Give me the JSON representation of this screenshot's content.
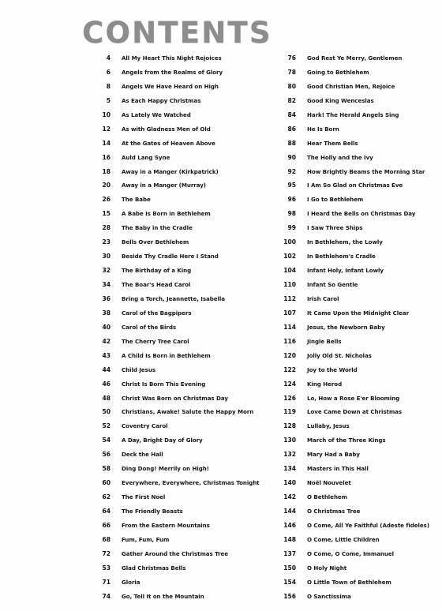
{
  "document": {
    "heading": "CONTENTS",
    "heading_color": "#8d8d8d",
    "background_color": "#ffffff",
    "text_color": "#161616"
  },
  "toc": {
    "left_column": [
      {
        "page": "4",
        "title": "All My Heart This Night Rejoices"
      },
      {
        "page": "6",
        "title": "Angels from the Realms of Glory"
      },
      {
        "page": "8",
        "title": "Angels We Have Heard on High"
      },
      {
        "page": "5",
        "title": "As Each Happy Christmas"
      },
      {
        "page": "10",
        "title": "As Lately We Watched"
      },
      {
        "page": "12",
        "title": "As with Gladness Men of Old"
      },
      {
        "page": "14",
        "title": "At the Gates of Heaven Above"
      },
      {
        "page": "16",
        "title": "Auld Lang Syne"
      },
      {
        "page": "18",
        "title": "Away in a Manger (Kirkpatrick)"
      },
      {
        "page": "20",
        "title": "Away in a Manger (Murray)"
      },
      {
        "page": "26",
        "title": "The Babe"
      },
      {
        "page": "15",
        "title": "A Babe Is Born in Bethlehem"
      },
      {
        "page": "28",
        "title": "The Baby in the Cradle"
      },
      {
        "page": "23",
        "title": "Bells Over Bethlehem"
      },
      {
        "page": "30",
        "title": "Beside Thy Cradle Here I Stand"
      },
      {
        "page": "32",
        "title": "The Birthday of a King"
      },
      {
        "page": "34",
        "title": "The Boar's Head Carol"
      },
      {
        "page": "36",
        "title": "Bring a Torch, Jeannette, Isabella"
      },
      {
        "page": "38",
        "title": "Carol of the Bagpipers"
      },
      {
        "page": "40",
        "title": "Carol of the Birds"
      },
      {
        "page": "42",
        "title": "The Cherry Tree Carol"
      },
      {
        "page": "43",
        "title": "A Child Is Born in Bethlehem"
      },
      {
        "page": "44",
        "title": "Child Jesus"
      },
      {
        "page": "46",
        "title": "Christ Is Born This Evening"
      },
      {
        "page": "48",
        "title": "Christ Was Born on Christmas Day"
      },
      {
        "page": "50",
        "title": "Christians, Awake! Salute the Happy Morn"
      },
      {
        "page": "52",
        "title": "Coventry Carol"
      },
      {
        "page": "54",
        "title": "A Day, Bright Day of Glory"
      },
      {
        "page": "56",
        "title": "Deck the Hall"
      },
      {
        "page": "58",
        "title": "Ding Dong! Merrily on High!"
      },
      {
        "page": "60",
        "title": "Everywhere, Everywhere, Christmas Tonight"
      },
      {
        "page": "62",
        "title": "The First Noel"
      },
      {
        "page": "64",
        "title": "The Friendly Beasts"
      },
      {
        "page": "66",
        "title": "From the Eastern Mountains"
      },
      {
        "page": "68",
        "title": "Fum, Fum, Fum"
      },
      {
        "page": "72",
        "title": "Gather Around the Christmas Tree"
      },
      {
        "page": "53",
        "title": "Glad Christmas Bells"
      },
      {
        "page": "71",
        "title": "Gloria"
      },
      {
        "page": "74",
        "title": "Go, Tell It on the Mountain"
      }
    ],
    "right_column": [
      {
        "page": "76",
        "title": "God Rest Ye Merry, Gentlemen"
      },
      {
        "page": "78",
        "title": "Going to Bethlehem"
      },
      {
        "page": "80",
        "title": "Good Christian Men, Rejoice"
      },
      {
        "page": "82",
        "title": "Good King Wenceslas"
      },
      {
        "page": "84",
        "title": "Hark! The Herald Angels Sing"
      },
      {
        "page": "86",
        "title": "He Is Born"
      },
      {
        "page": "88",
        "title": "Hear Them Bells"
      },
      {
        "page": "90",
        "title": "The Holly and the Ivy"
      },
      {
        "page": "92",
        "title": "How Brightly Beams the Morning Star"
      },
      {
        "page": "95",
        "title": "I Am So Glad on Christmas Eve"
      },
      {
        "page": "96",
        "title": "I Go to Bethlehem"
      },
      {
        "page": "98",
        "title": "I Heard the Bells on Christmas Day"
      },
      {
        "page": "99",
        "title": "I Saw Three Ships"
      },
      {
        "page": "100",
        "title": "In Bethlehem, the Lowly"
      },
      {
        "page": "102",
        "title": "In Bethlehem's Cradle"
      },
      {
        "page": "104",
        "title": "Infant Holy, Infant Lowly"
      },
      {
        "page": "110",
        "title": "Infant So Gentle"
      },
      {
        "page": "112",
        "title": "Irish Carol"
      },
      {
        "page": "107",
        "title": "It Came Upon the Midnight Clear"
      },
      {
        "page": "114",
        "title": "Jesus, the Newborn Baby"
      },
      {
        "page": "116",
        "title": "Jingle Bells"
      },
      {
        "page": "120",
        "title": "Jolly Old St. Nicholas"
      },
      {
        "page": "122",
        "title": "Joy to the World"
      },
      {
        "page": "124",
        "title": "King Herod"
      },
      {
        "page": "126",
        "title": "Lo, How a Rose E'er Blooming"
      },
      {
        "page": "119",
        "title": "Love Came Down at Christmas"
      },
      {
        "page": "128",
        "title": "Lullaby, Jesus"
      },
      {
        "page": "130",
        "title": "March of the Three Kings"
      },
      {
        "page": "132",
        "title": "Mary Had a Baby"
      },
      {
        "page": "134",
        "title": "Masters in This Hall"
      },
      {
        "page": "140",
        "title": "Noël Nouvelet"
      },
      {
        "page": "142",
        "title": "O Bethlehem"
      },
      {
        "page": "144",
        "title": "O Christmas Tree"
      },
      {
        "page": "146",
        "title": "O Come, All Ye Faithful (Adeste fideles)"
      },
      {
        "page": "148",
        "title": "O Come, Little Children"
      },
      {
        "page": "137",
        "title": "O Come, O Come, Immanuel"
      },
      {
        "page": "150",
        "title": "O Holy Night"
      },
      {
        "page": "154",
        "title": "O Little Town of Bethlehem"
      },
      {
        "page": "156",
        "title": "O Sanctissima"
      }
    ]
  }
}
